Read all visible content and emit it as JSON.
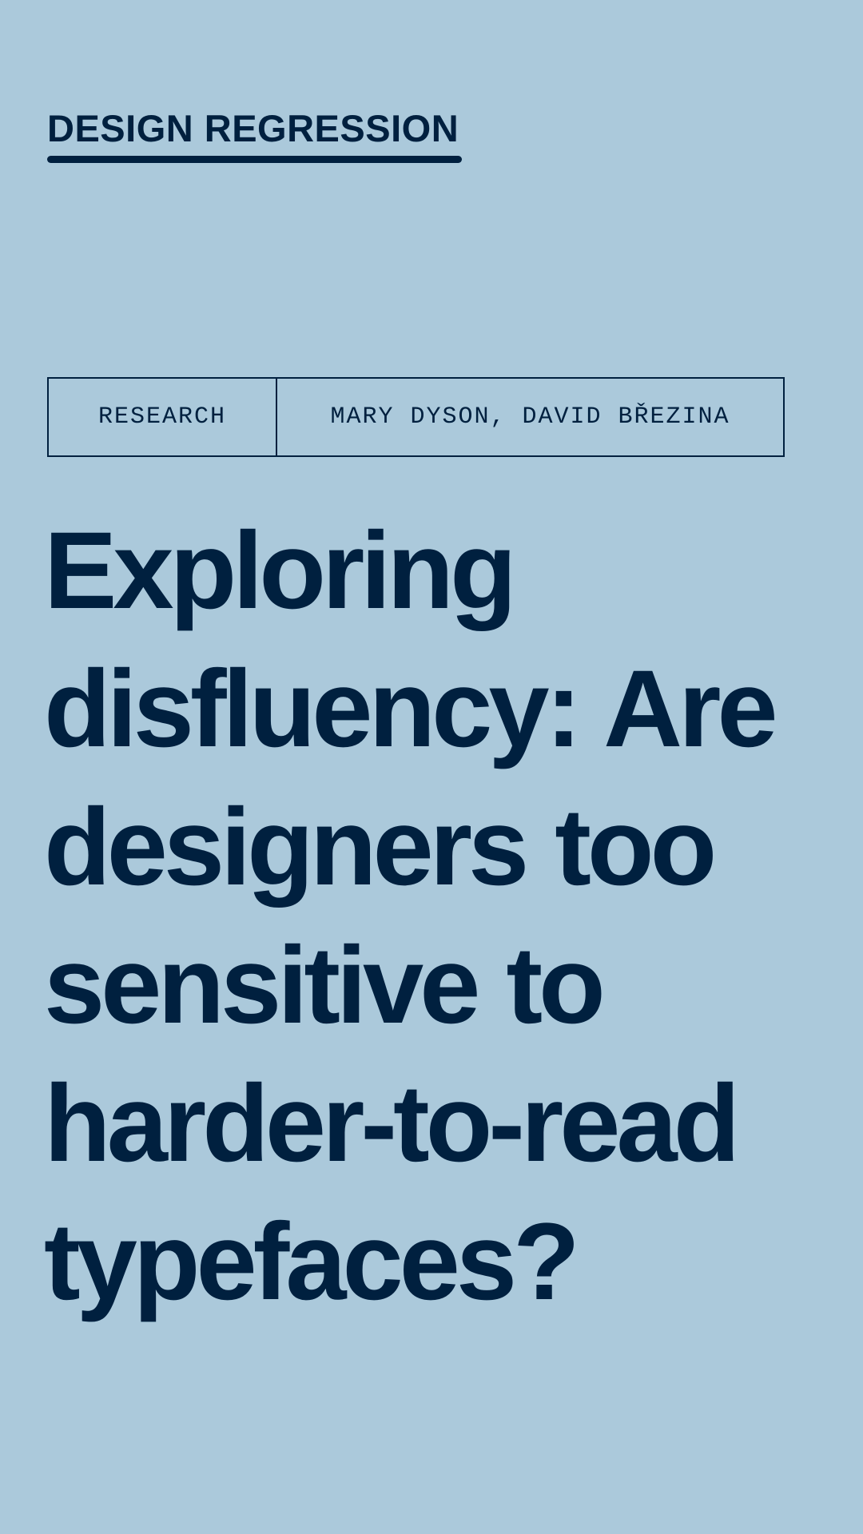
{
  "header": {
    "site_title": "DESIGN REGRESSION"
  },
  "article": {
    "category": "RESEARCH",
    "authors": "MARY DYSON, DAVID BŘEZINA",
    "title": "Exploring disfluency: Are designers too sensitive to harder-to-read typefaces?"
  },
  "colors": {
    "background": "#abc9db",
    "ink": "#00203f"
  }
}
